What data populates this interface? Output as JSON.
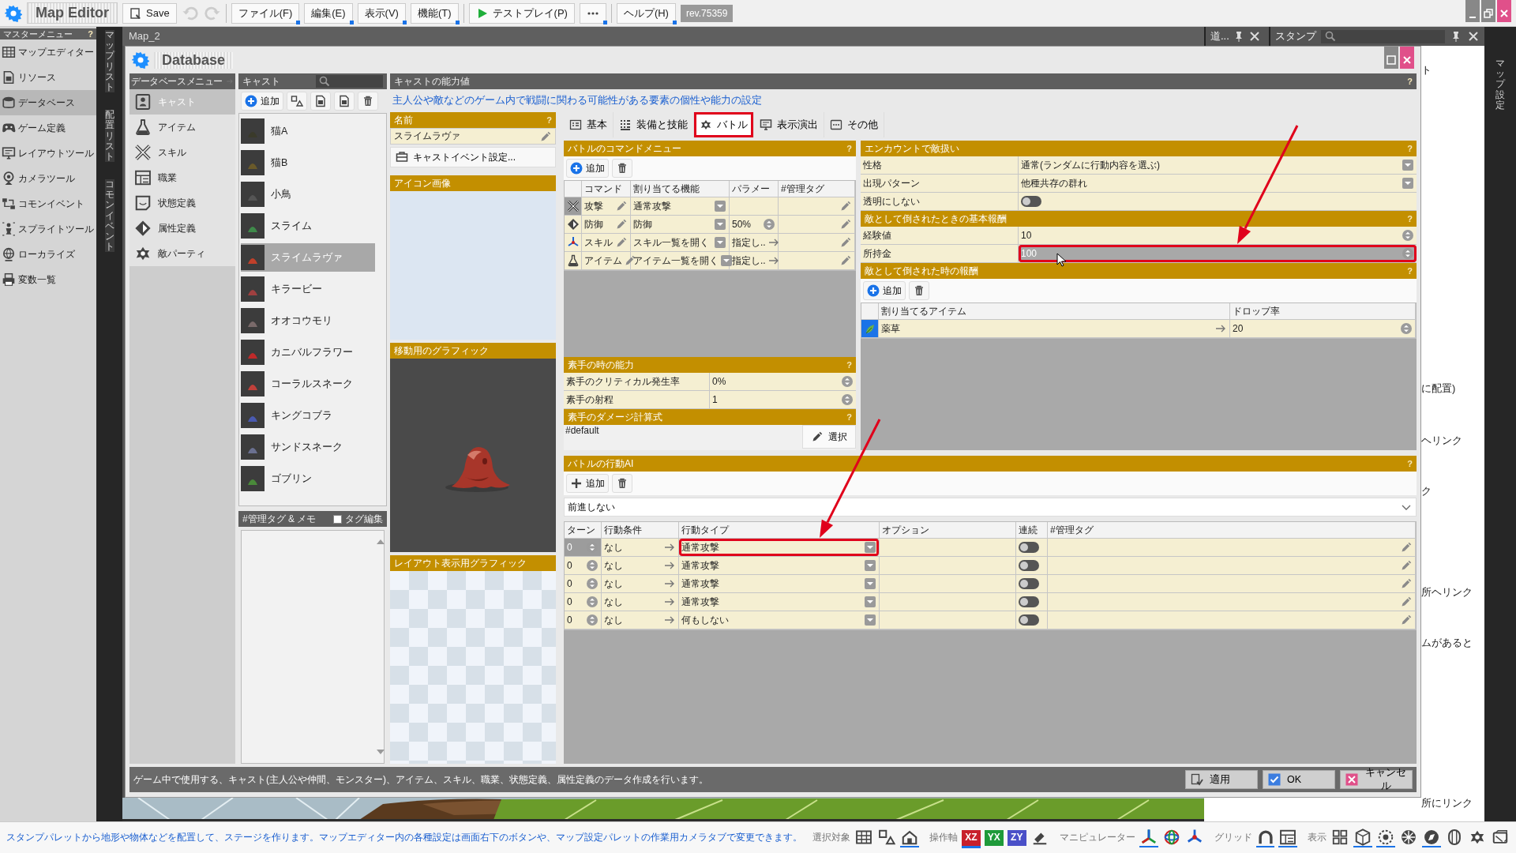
{
  "app": {
    "title": "Map Editor",
    "save": "Save",
    "menus": [
      {
        "label": "ファイル(F)"
      },
      {
        "label": "編集(E)"
      },
      {
        "label": "表示(V)"
      },
      {
        "label": "機能(T)"
      }
    ],
    "test_play": "テストプレイ(P)",
    "help_menu": "ヘルプ(H)",
    "revision": "rev.75359"
  },
  "master_menu": {
    "title": "マスターメニュー",
    "help": "?",
    "items": [
      {
        "label": "マップエディター",
        "selected": false
      },
      {
        "label": "リソース",
        "selected": false
      },
      {
        "label": "データベース",
        "selected": true
      },
      {
        "label": "ゲーム定義",
        "selected": false
      },
      {
        "label": "レイアウトツール",
        "selected": false
      },
      {
        "label": "カメラツール",
        "selected": false
      },
      {
        "label": "コモンイベント",
        "selected": false
      },
      {
        "label": "スプライトツール",
        "selected": false
      },
      {
        "label": "ローカライズ",
        "selected": false
      },
      {
        "label": "変数一覧",
        "selected": false
      }
    ]
  },
  "side_tabs": [
    {
      "label": "マップリスト"
    },
    {
      "label": "配置リスト"
    },
    {
      "label": "コモンイベント"
    }
  ],
  "document_tab": {
    "label": "Map_2"
  },
  "dock_panels": [
    {
      "title": "道...",
      "search": false
    },
    {
      "title": "スタンプ",
      "search": true
    }
  ],
  "background_texts": [
    "ト",
    "に配置)",
    "ヘリンク",
    "ク",
    "所ヘリンク",
    "ムがあると",
    "所にリンク"
  ],
  "right_dock": {
    "label": "マップ設定"
  },
  "dialog": {
    "title": "Database",
    "db_menu": {
      "title": "データベースメニュー",
      "items": [
        {
          "label": "キャスト",
          "selected": true
        },
        {
          "label": "アイテム",
          "selected": false
        },
        {
          "label": "スキル",
          "selected": false
        },
        {
          "label": "職業",
          "selected": false
        },
        {
          "label": "状態定義",
          "selected": false
        },
        {
          "label": "属性定義",
          "selected": false
        },
        {
          "label": "敵パーティ",
          "selected": false
        }
      ]
    },
    "cast_list": {
      "title": "キャスト",
      "add": "追加",
      "items": [
        {
          "name": "猫A",
          "selected": false
        },
        {
          "name": "猫B",
          "selected": false
        },
        {
          "name": "小鳥",
          "selected": false
        },
        {
          "name": "スライム",
          "selected": false
        },
        {
          "name": "スライムラヴァ",
          "selected": true
        },
        {
          "name": "キラービー",
          "selected": false
        },
        {
          "name": "オオコウモリ",
          "selected": false
        },
        {
          "name": "カニバルフラワー",
          "selected": false
        },
        {
          "name": "コーラルスネーク",
          "selected": false
        },
        {
          "name": "キングコブラ",
          "selected": false
        },
        {
          "name": "サンドスネーク",
          "selected": false
        },
        {
          "name": "ゴブリン",
          "selected": false
        }
      ]
    },
    "memo": {
      "title": "#管理タグ & メモ",
      "tag_edit": {
        "label": "タグ編集",
        "checked": false
      }
    },
    "detail": {
      "title": "キャストの能力値",
      "help": "?",
      "description": "主人公や敵などのゲーム内で戦闘に関わる可能性がある要素の個性や能力の設定",
      "name": {
        "title": "名前",
        "help": "?",
        "value": "スライムラヴァ",
        "event_button": "キャストイベント設定..."
      },
      "graphics": [
        {
          "title": "アイコン画像",
          "kind": "blank"
        },
        {
          "title": "移動用のグラフィック",
          "kind": "picture"
        },
        {
          "title": "レイアウト表示用グラフィック",
          "kind": "transparent"
        }
      ],
      "tabs": [
        {
          "label": "基本",
          "selected": false,
          "highlighted": false
        },
        {
          "label": "装備と技能",
          "selected": false,
          "highlighted": false
        },
        {
          "label": "バトル",
          "selected": true,
          "highlighted": true
        },
        {
          "label": "表示演出",
          "selected": false,
          "highlighted": false
        },
        {
          "label": "その他",
          "selected": false,
          "highlighted": false
        }
      ],
      "command_menu": {
        "title": "バトルのコマンドメニュー",
        "help": "?",
        "add": "追加",
        "columns": [
          "コマンド",
          "割り当てる機能",
          "パラメー",
          "#管理タグ"
        ],
        "rows": [
          {
            "selected": true,
            "command": "攻撃",
            "function": "通常攻撃",
            "parameter": {
              "kind": "none"
            }
          },
          {
            "selected": false,
            "command": "防御",
            "function": "防御",
            "parameter": {
              "kind": "spinner",
              "value": "50%"
            }
          },
          {
            "selected": false,
            "command": "スキル",
            "function": "スキル一覧を開く",
            "parameter": {
              "kind": "link",
              "value": "指定し.."
            }
          },
          {
            "selected": false,
            "command": "アイテム",
            "function": "アイテム一覧を開く",
            "parameter": {
              "kind": "link",
              "value": "指定し.."
            }
          }
        ]
      },
      "unarmed": {
        "title": "素手の時の能力",
        "help": "?",
        "rows": [
          {
            "label": "素手のクリティカル発生率",
            "value": "0%"
          },
          {
            "label": "素手の射程",
            "value": "1"
          }
        ]
      },
      "formula": {
        "title": "素手のダメージ計算式",
        "help": "?",
        "value": "#default",
        "button": "選択"
      },
      "encounter": [
        {
          "title": "エンカウントで敵扱い",
          "help": "?",
          "rows": [
            {
              "label": "性格",
              "kind": "dropdown",
              "value": "通常(ランダムに行動内容を選ぶ)",
              "selected": false,
              "highlighted": false
            },
            {
              "label": "出現パターン",
              "kind": "dropdown",
              "value": "他種共存の群れ",
              "selected": false,
              "highlighted": false
            },
            {
              "label": "透明にしない",
              "kind": "toggle",
              "on": false,
              "selected": false,
              "highlighted": false
            }
          ]
        },
        {
          "title": "敵として倒されたときの基本報酬",
          "help": "?",
          "rows": [
            {
              "label": "経験値",
              "kind": "spinner",
              "value": "10",
              "selected": false,
              "highlighted": false
            },
            {
              "label": "所持金",
              "kind": "spinner",
              "value": "100",
              "selected": true,
              "highlighted": true
            }
          ]
        }
      ],
      "drops": {
        "title": "敵として倒された時の報酬",
        "help": "?",
        "add": "追加",
        "columns": [
          "割り当てるアイテム",
          "ドロップ率"
        ],
        "rows": [
          {
            "item": "薬草",
            "rate": "20"
          }
        ]
      },
      "ai": {
        "title": "バトルの行動AI",
        "help": "?",
        "add": "追加",
        "mode": "前進しない",
        "columns": [
          "ターン",
          "行動条件",
          "行動タイプ",
          "オプション",
          "連続",
          "#管理タグ"
        ],
        "rows": [
          {
            "selected": true,
            "turn": "0",
            "condition": "なし",
            "type": "通常攻撃",
            "continuous": false,
            "highlighted": true
          },
          {
            "selected": false,
            "turn": "0",
            "condition": "なし",
            "type": "通常攻撃",
            "continuous": false,
            "highlighted": false
          },
          {
            "selected": false,
            "turn": "0",
            "condition": "なし",
            "type": "通常攻撃",
            "continuous": false,
            "highlighted": false
          },
          {
            "selected": false,
            "turn": "0",
            "condition": "なし",
            "type": "通常攻撃",
            "continuous": false,
            "highlighted": false
          },
          {
            "selected": false,
            "turn": "0",
            "condition": "なし",
            "type": "何もしない",
            "continuous": false,
            "highlighted": false
          }
        ]
      }
    },
    "footer": {
      "description": "ゲーム中で使用する、キャスト(主人公や仲間、モンスター)、アイテム、スキル、職業、状態定義、属性定義のデータ作成を行います。",
      "buttons": [
        {
          "label": "適用",
          "kind": "apply"
        },
        {
          "label": "OK",
          "kind": "ok"
        },
        {
          "label": "キャンセル",
          "kind": "cancel"
        }
      ]
    }
  },
  "status_bar": {
    "message": "スタンプパレットから地形や物体などを配置して、ステージを作ります。マップエディター内の各種設定は画面右下のボタンや、マップ設定パレットの作業用カメラタブで変更できます。",
    "groups": [
      {
        "label": "選択対象",
        "tools": [
          {
            "on": false
          },
          {
            "on": false
          },
          {
            "on": true
          }
        ]
      },
      {
        "label": "操作軸",
        "tools": [
          {
            "text": "XZ",
            "on": true,
            "color": "#c8202c"
          },
          {
            "text": "YX",
            "on": false,
            "color": "#1f9a3a"
          },
          {
            "text": "ZY",
            "on": false,
            "color": "#4a50c8"
          }
        ]
      },
      {
        "tools": [
          {
            "on": false
          }
        ]
      },
      {
        "label": "マニピュレーター",
        "tools": [
          {
            "on": true
          },
          {
            "on": false
          },
          {
            "on": false
          }
        ]
      },
      {
        "label": "グリッド",
        "tools": [
          {
            "on": true
          },
          {
            "on": true
          }
        ]
      },
      {
        "label": "表示",
        "tools": [
          {
            "on": false
          },
          {
            "on": true
          },
          {
            "on": true
          },
          {
            "on": false
          },
          {
            "on": true
          },
          {
            "on": false
          },
          {
            "on": false
          },
          {
            "on": false
          }
        ]
      }
    ]
  }
}
